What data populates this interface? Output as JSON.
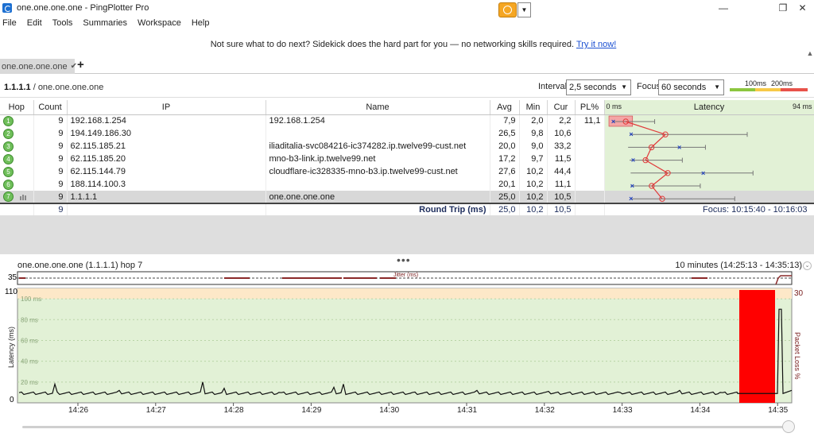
{
  "window": {
    "title": "one.one.one.one - PingPlotter Pro",
    "minimize": "—",
    "restore": "❐",
    "close": "✕"
  },
  "menu": [
    "File",
    "Edit",
    "Tools",
    "Summaries",
    "Workspace",
    "Help"
  ],
  "banner": {
    "text": "Not sure what to do next? Sidekick does the hard part for you — no networking skills required.",
    "link": "Try it now!"
  },
  "tabs": [
    {
      "label": "one.one.one.one"
    }
  ],
  "add_tab": "+",
  "target": {
    "ip": "1.1.1.1",
    "host": "one.one.one.one"
  },
  "controls": {
    "interval_label": "Interval",
    "interval_value": "2,5 seconds",
    "focus_label": "Focus",
    "focus_value": "60 seconds",
    "scale_100": "100ms",
    "scale_200": "200ms"
  },
  "colors": {
    "scale_green": "#8cc63f",
    "scale_yellow": "#f7c948",
    "scale_red": "#e8524a",
    "graph_bg": "#e2f1d6",
    "alert_band": "#fde8c8",
    "loss": "#ff0000"
  },
  "columns": {
    "hop": "Hop",
    "count": "Count",
    "ip": "IP",
    "name": "Name",
    "avg": "Avg",
    "min": "Min",
    "cur": "Cur",
    "pl": "PL%",
    "latency_min": "0 ms",
    "latency": "Latency",
    "latency_max": "94 ms"
  },
  "hops": [
    {
      "hop": "1",
      "count": "9",
      "ip": "192.168.1.254",
      "name": "192.168.1.254",
      "avg": "7,9",
      "min": "2,0",
      "cur": "2,2",
      "pl": "11,1"
    },
    {
      "hop": "2",
      "count": "9",
      "ip": "194.149.186.30",
      "name": "",
      "avg": "26,5",
      "min": "9,8",
      "cur": "10,6",
      "pl": ""
    },
    {
      "hop": "3",
      "count": "9",
      "ip": "62.115.185.21",
      "name": "iliaditalia-svc084216-ic374282.ip.twelve99-cust.net",
      "avg": "20,0",
      "min": "9,0",
      "cur": "33,2",
      "pl": ""
    },
    {
      "hop": "4",
      "count": "9",
      "ip": "62.115.185.20",
      "name": "mno-b3-link.ip.twelve99.net",
      "avg": "17,2",
      "min": "9,7",
      "cur": "11,5",
      "pl": ""
    },
    {
      "hop": "5",
      "count": "9",
      "ip": "62.115.144.79",
      "name": "cloudflare-ic328335-mno-b3.ip.twelve99-cust.net",
      "avg": "27,6",
      "min": "10,2",
      "cur": "44,4",
      "pl": ""
    },
    {
      "hop": "6",
      "count": "9",
      "ip": "188.114.100.3",
      "name": "",
      "avg": "20,1",
      "min": "10,2",
      "cur": "11,1",
      "pl": ""
    },
    {
      "hop": "7",
      "count": "9",
      "ip": "1.1.1.1",
      "name": "one.one.one.one",
      "avg": "25,0",
      "min": "10,2",
      "cur": "10,5",
      "pl": ""
    }
  ],
  "round_trip": {
    "count": "9",
    "label": "Round Trip (ms)",
    "avg": "25,0",
    "min": "10,2",
    "cur": "10,5",
    "focus": "Focus: 10:15:40 - 10:16:03"
  },
  "graph": {
    "title": "one.one.one.one (1.1.1.1) hop 7",
    "range": "10 minutes (14:25:13 - 14:35:13)",
    "jitter_label": "Jitter (ms)",
    "jitter_max": "35",
    "latency_max": "110",
    "latency_zero": "0",
    "y_axis_label": "Latency (ms)",
    "y2_axis_label": "Packet Loss %",
    "loss_max": "30",
    "gridlines": [
      "100 ms",
      "80 ms",
      "60 ms",
      "40 ms",
      "20 ms"
    ],
    "time_ticks": [
      "14:26",
      "14:27",
      "14:28",
      "14:29",
      "14:30",
      "14:31",
      "14:32",
      "14:33",
      "14:34",
      "14:35"
    ]
  }
}
